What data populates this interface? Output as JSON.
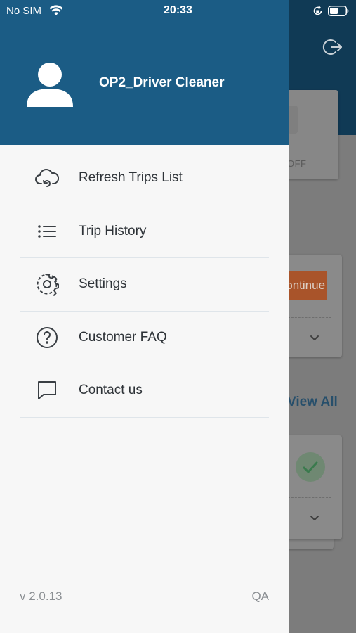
{
  "status_bar": {
    "carrier": "No SIM",
    "time": "20:33",
    "icons": [
      "wifi-icon",
      "orientation-lock-icon",
      "battery-icon"
    ]
  },
  "drawer": {
    "user_name": "OP2_Driver Cleaner",
    "avatar_icon": "user-avatar-icon",
    "menu": [
      {
        "label": "Refresh Trips List",
        "icon": "cloud-refresh-icon"
      },
      {
        "label": "Trip History",
        "icon": "list-icon"
      },
      {
        "label": "Settings",
        "icon": "gear-icon"
      },
      {
        "label": "Customer FAQ",
        "icon": "question-circle-icon"
      },
      {
        "label": "Contact us",
        "icon": "chat-bubble-icon"
      }
    ],
    "version": "v 2.0.13",
    "environment": "QA"
  },
  "background": {
    "toggle_state": "OFF",
    "continue_button": "Continue",
    "view_all_link": "View All",
    "logout_icon": "logout-icon"
  },
  "colors": {
    "drawer_header": "#1b5c85",
    "drawer_body": "#f7f7f7",
    "text": "#2e3338",
    "muted_text": "#8c9094",
    "accent_orange": "#e0622a",
    "accent_link": "#1e5f8c"
  }
}
